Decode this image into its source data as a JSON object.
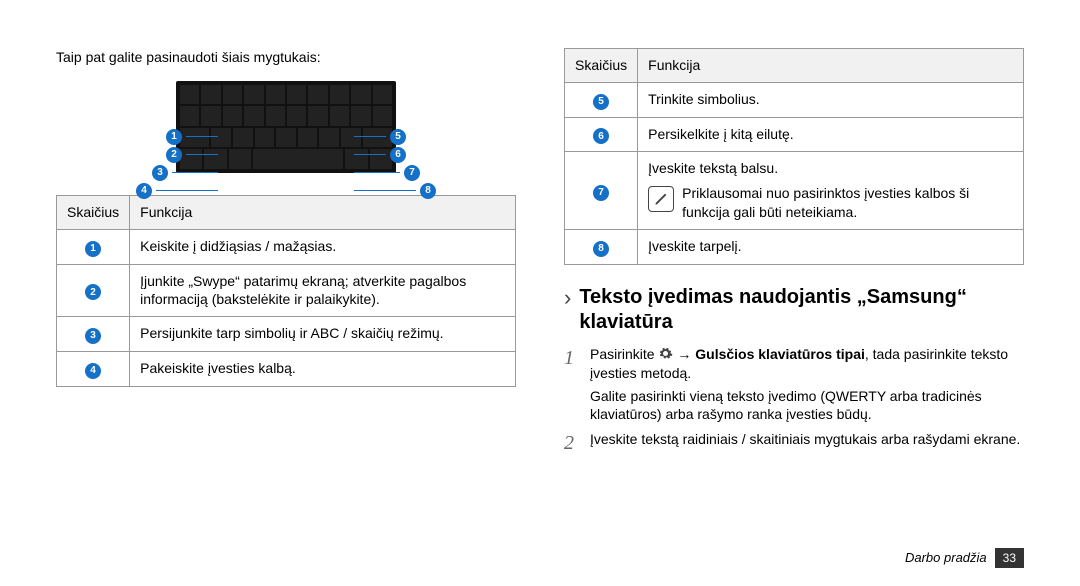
{
  "left": {
    "intro": "Taip pat galite pasinaudoti šiais mygtukais:",
    "callouts": [
      "1",
      "2",
      "3",
      "4",
      "5",
      "6",
      "7",
      "8"
    ],
    "table": {
      "head": {
        "col1": "Skaičius",
        "col2": "Funkcija"
      },
      "rows": [
        {
          "n": "1",
          "text": "Keiskite į didžiąsias / mažąsias."
        },
        {
          "n": "2",
          "text": "Įjunkite „Swype“ patarimų ekraną; atverkite pagalbos informaciją (bakstelėkite ir palaikykite)."
        },
        {
          "n": "3",
          "text": "Persijunkite tarp simbolių ir ABC / skaičių režimų."
        },
        {
          "n": "4",
          "text": "Pakeiskite įvesties kalbą."
        }
      ]
    }
  },
  "right": {
    "table": {
      "head": {
        "col1": "Skaičius",
        "col2": "Funkcija"
      },
      "rows": [
        {
          "n": "5",
          "text": "Trinkite simbolius."
        },
        {
          "n": "6",
          "text": "Persikelkite į kitą eilutę."
        },
        {
          "n": "7",
          "text": "Įveskite tekstą balsu.",
          "note": "Priklausomai nuo pasirinktos įvesties kalbos ši funkcija gali būti neteikiama."
        },
        {
          "n": "8",
          "text": "Įveskite tarpelį."
        }
      ]
    },
    "section_title": "Teksto įvedimas naudojantis „Samsung“ klaviatūra",
    "steps": {
      "s1a": "Pasirinkite ",
      "s1b": " → ",
      "s1c": "Gulsčios klaviatūros tipai",
      "s1d": ", tada pasirinkite teksto įvesties metodą.",
      "s1e": "Galite pasirinkti vieną teksto įvedimo (QWERTY arba tradicinės klaviatūros) arba rašymo ranka įvesties būdų.",
      "s2": "Įveskite tekstą raidiniais / skaitiniais mygtukais arba rašydami ekrane."
    }
  },
  "footer": {
    "section": "Darbo pradžia",
    "page": "33"
  }
}
